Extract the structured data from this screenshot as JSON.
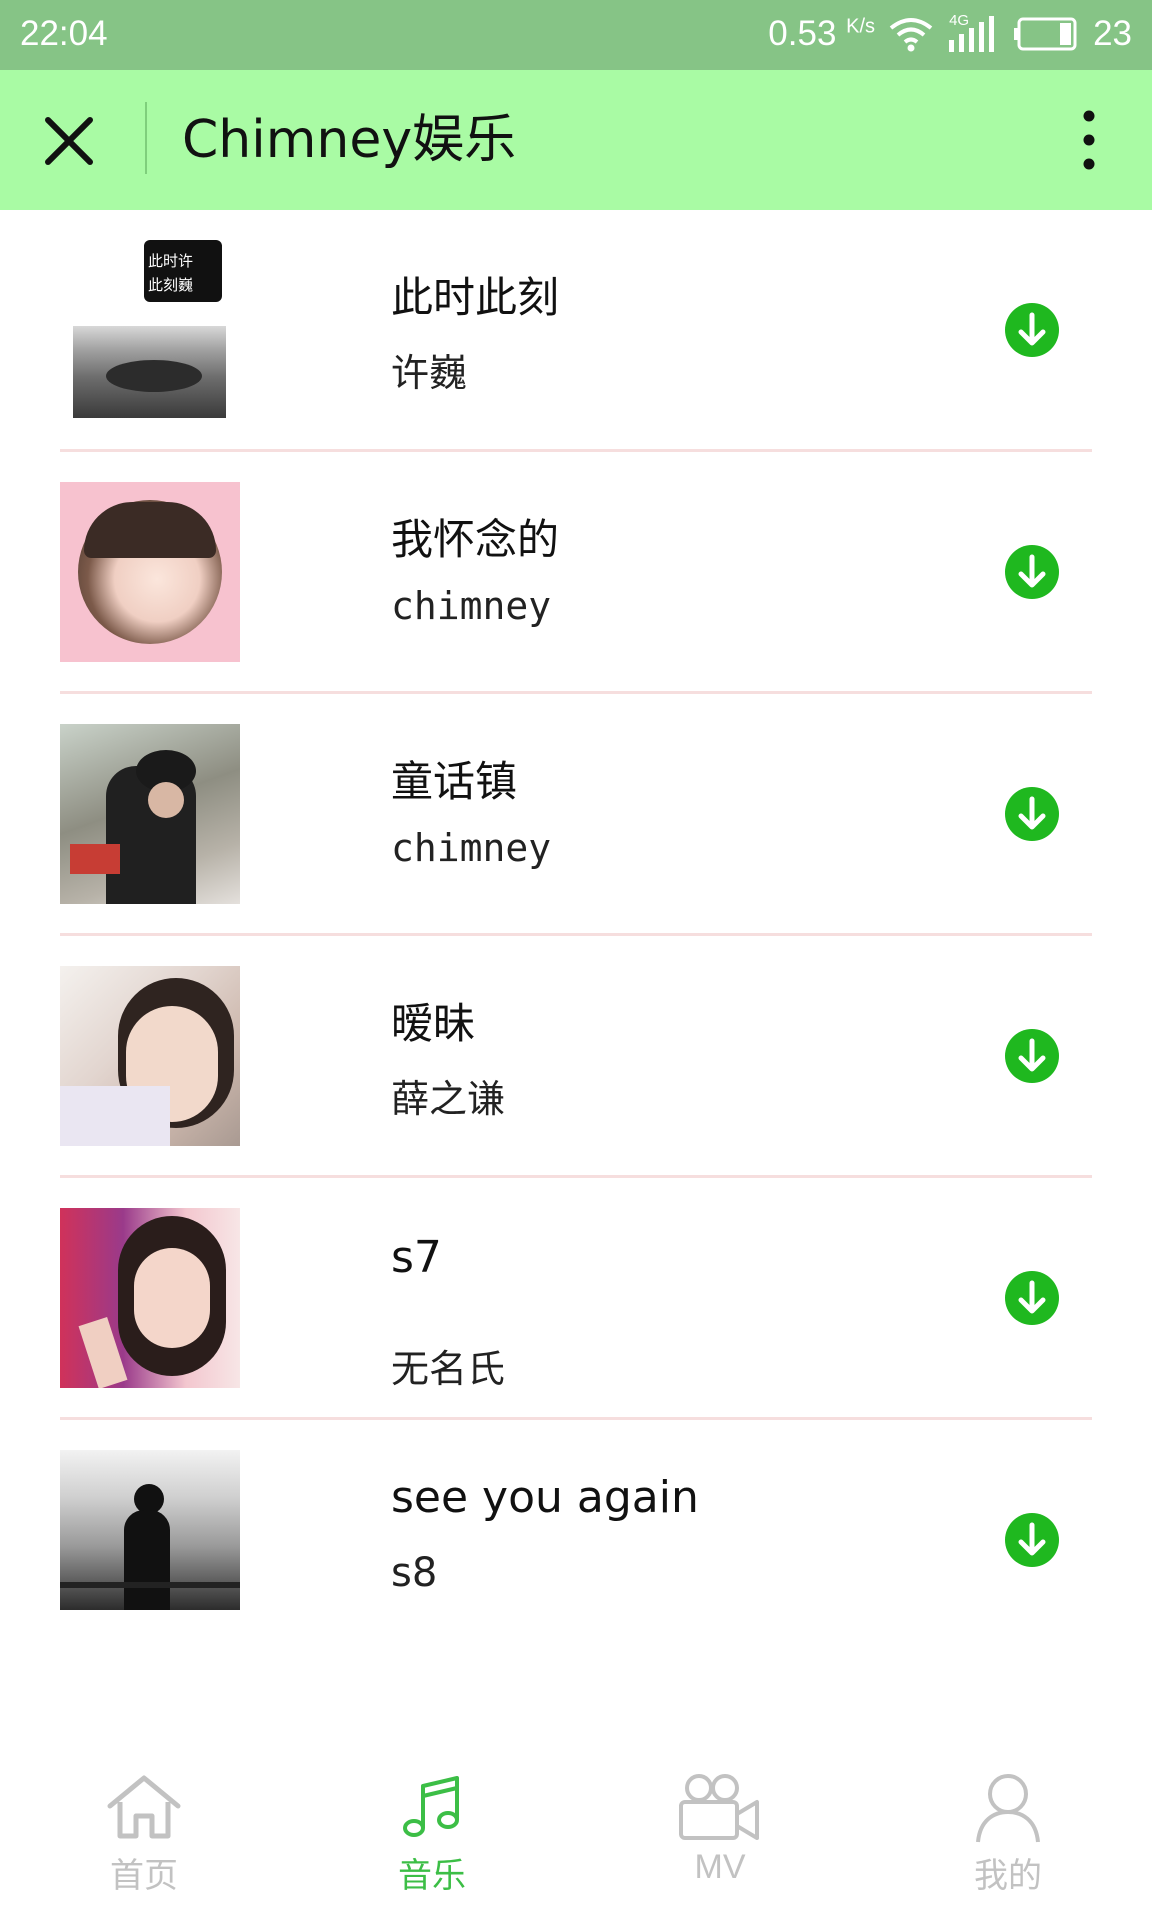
{
  "status_bar": {
    "time": "22:04",
    "speed": "0.53",
    "speed_unit": "K/s",
    "network": "4G",
    "battery": "23"
  },
  "header": {
    "title": "Chimney娱乐",
    "close_icon": "close-icon",
    "more_icon": "more-vertical-icon"
  },
  "songs": [
    {
      "title": "此时此刻",
      "artist": "许巍",
      "cover_text": [
        "此时许",
        "此刻巍"
      ]
    },
    {
      "title": "我怀念的",
      "artist": "chimney"
    },
    {
      "title": "童话镇",
      "artist": "chimney"
    },
    {
      "title": "暧昧",
      "artist": "薛之谦"
    },
    {
      "title": "s7",
      "artist": "无名氏"
    },
    {
      "title": "see you again",
      "artist": "s8"
    }
  ],
  "tabs": [
    {
      "label": "首页",
      "icon": "home-icon",
      "active": false
    },
    {
      "label": "音乐",
      "icon": "music-note-icon",
      "active": true
    },
    {
      "label": "MV",
      "icon": "video-camera-icon",
      "active": false
    },
    {
      "label": "我的",
      "icon": "user-icon",
      "active": false
    }
  ],
  "colors": {
    "status_bar": "#86c486",
    "header": "#a9fba4",
    "download": "#1fb81f",
    "active_tab": "#3cbe46",
    "inactive_tab": "#c2c2c2"
  }
}
